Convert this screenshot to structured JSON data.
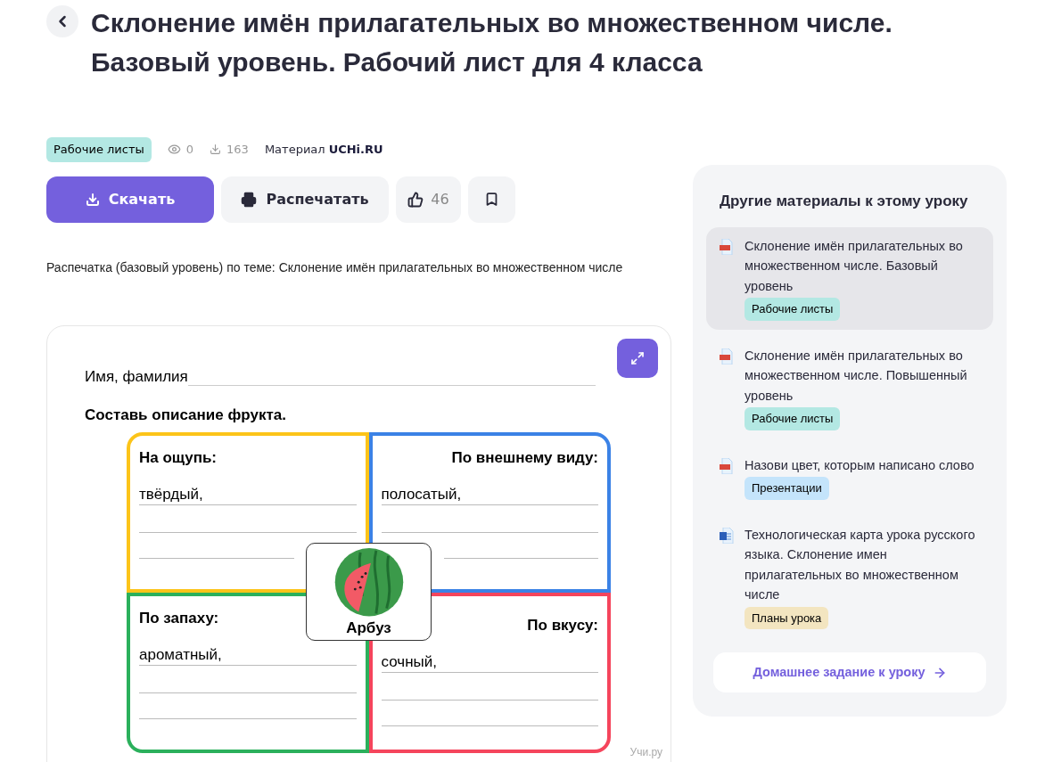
{
  "title": "Склонение имён прилагательных во множественном числе. Базовый уровень. Рабочий лист для 4 класса",
  "meta": {
    "tag": "Рабочие листы",
    "views": "0",
    "downloads": "163",
    "source_label": "Материал",
    "source_brand": "UCHi.RU"
  },
  "actions": {
    "download": "Скачать",
    "print": "Распечатать",
    "likes": "46"
  },
  "description": "Распечатка (базовый уровень) по теме: Склонение имён прилагательных во множественном числе",
  "worksheet": {
    "name_label": "Имя, фамилия",
    "task": "Составь описание фрукта.",
    "quadrants": [
      {
        "heading": "На ощупь:",
        "answer": "твёрдый,",
        "color": "#fcc419"
      },
      {
        "heading": "По внешнему виду:",
        "answer": "полосатый,",
        "color": "#3b82e6"
      },
      {
        "heading": "По запаху:",
        "answer": "ароматный,",
        "color": "#2bb05c"
      },
      {
        "heading": "По вкусу:",
        "answer": "сочный,",
        "color": "#f5455c"
      }
    ],
    "center_label": "Арбуз",
    "credit": "Учи.ру"
  },
  "sidebar": {
    "title": "Другие материалы к этому уроку",
    "items": [
      {
        "kind": "pdf",
        "title": "Склонение имён прилагательных во множественном числе. Базовый уровень",
        "tag": "Рабочие листы",
        "color": "#b3e8e3",
        "selected": true
      },
      {
        "kind": "pdf",
        "title": "Склонение имён прилагательных во множественном числе. Повышенный уровень",
        "tag": "Рабочие листы",
        "color": "#b3e8e3",
        "selected": false
      },
      {
        "kind": "pdf",
        "title": "Назови цвет, которым написано слово",
        "tag": "Презентации",
        "color": "#c4e4fb",
        "selected": false
      },
      {
        "kind": "word",
        "title": "Технологическая карта урока русского языка. Склонение имен прилагательных во множественном числе",
        "tag": "Планы урока",
        "color": "#f3e5c0",
        "selected": false
      }
    ],
    "homework": "Домашнее задание к уроку"
  }
}
